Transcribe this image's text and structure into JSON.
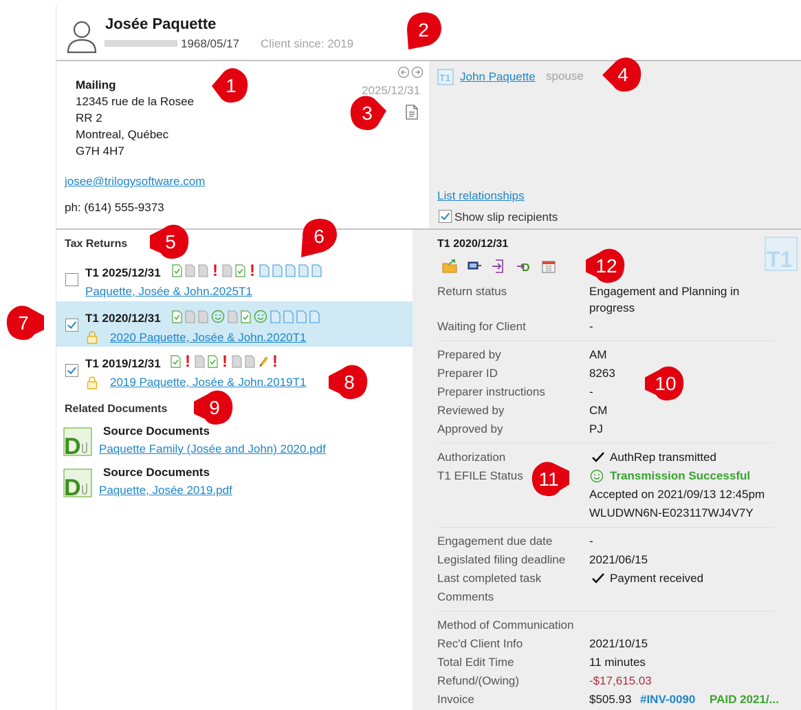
{
  "client": {
    "name": "Josée Paquette",
    "dob": "1968/05/17",
    "client_since": "Client since: 2019"
  },
  "address": {
    "heading": "Mailing",
    "line1": "12345 rue de la Rosee",
    "line2": "RR 2",
    "line3": "Montreal, Québec",
    "line4": "G7H 4H7",
    "email": "josee@trilogysoftware.com",
    "phone": "ph: (614) 555-9373",
    "date": "2025/12/31"
  },
  "relationships": {
    "person": "John Paquette",
    "role": "spouse",
    "list_link": "List relationships",
    "show_slip": "Show slip recipients"
  },
  "tax_returns": {
    "heading": "Tax Returns",
    "items": [
      {
        "title": "T1 2025/12/31",
        "link": "Paquette, Josée & John.2025T1"
      },
      {
        "title": "T1 2020/12/31",
        "link": "2020 Paquette, Josée & John.2020T1"
      },
      {
        "title": "T1 2019/12/31",
        "link": "2019 Paquette, Josée & John.2019T1"
      }
    ]
  },
  "related_docs": {
    "heading": "Related Documents",
    "items": [
      {
        "type": "Source Documents",
        "file": "Paquette Family (Josée and John) 2020.pdf"
      },
      {
        "type": "Source Documents",
        "file": "Paquette, Josée 2019.pdf"
      }
    ]
  },
  "detail": {
    "title": "T1 2020/12/31",
    "return_status_label": "Return status",
    "return_status_line1": "Engagement and Planning in",
    "return_status_line2": "progress",
    "waiting_label": "Waiting for Client",
    "waiting_value": "-",
    "prepared_by_label": "Prepared by",
    "prepared_by_value": "AM",
    "preparer_id_label": "Preparer ID",
    "preparer_id_value": "8263",
    "preparer_instr_label": "Preparer instructions",
    "preparer_instr_value": "-",
    "reviewed_by_label": "Reviewed by",
    "reviewed_by_value": "CM",
    "approved_by_label": "Approved by",
    "approved_by_value": "PJ",
    "authorization_label": "Authorization",
    "authorization_value": "AuthRep transmitted",
    "efile_label": "T1 EFILE Status",
    "efile_status": "Transmission Successful",
    "efile_accepted": "Accepted on 2021/09/13 12:45pm",
    "efile_code": "WLUDWN6N-E023117WJ4V7Y",
    "engagement_due_label": "Engagement due date",
    "engagement_due_value": "-",
    "filing_deadline_label": "Legislated filing deadline",
    "filing_deadline_value": "2021/06/15",
    "last_task_label": "Last completed task",
    "last_task_value": "Payment received",
    "comments_label": "Comments",
    "method_label": "Method of Communication",
    "recd_label": "Rec'd Client Info",
    "recd_value": "2021/10/15",
    "edit_time_label": "Total Edit Time",
    "edit_time_value": "11 minutes",
    "refund_label": "Refund/(Owing)",
    "refund_value": "-$17,615.03",
    "invoice_label": "Invoice",
    "invoice_amount": "$505.93",
    "invoice_number": "#INV-0090",
    "invoice_paid": "PAID 2021/..."
  },
  "callouts": [
    "1",
    "2",
    "3",
    "4",
    "5",
    "6",
    "7",
    "8",
    "9",
    "10",
    "11",
    "12"
  ],
  "colors": {
    "accent": "#1e86c9",
    "success": "#3aa32f",
    "error": "#e0141f",
    "negative": "#a8323a",
    "selected_row": "#cfe9f5",
    "right_panel": "#eeeeee",
    "callout": "#e3000f"
  }
}
